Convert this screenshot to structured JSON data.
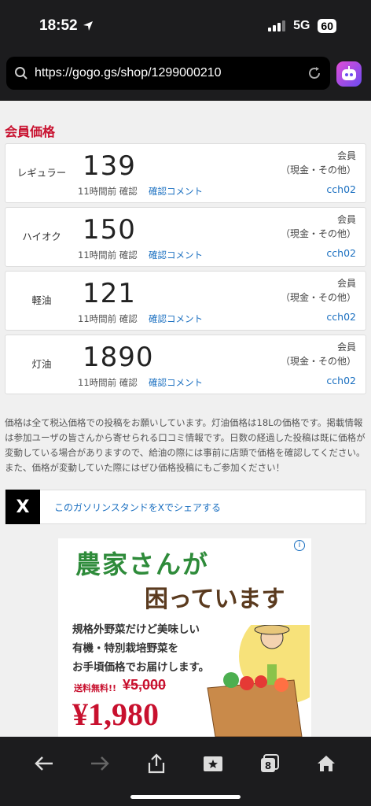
{
  "status": {
    "time": "18:52",
    "network": "5G",
    "battery": "60"
  },
  "browser": {
    "url": "https://gogo.gs/shop/1299000210"
  },
  "section_title": "会員価格",
  "prices": [
    {
      "label": "レギュラー",
      "price": "139",
      "time": "11時間前 確認",
      "comment": "確認コメント",
      "member": "会員",
      "pay": "（現金・その他）",
      "user": "cch02"
    },
    {
      "label": "ハイオク",
      "price": "150",
      "time": "11時間前 確認",
      "comment": "確認コメント",
      "member": "会員",
      "pay": "（現金・その他）",
      "user": "cch02"
    },
    {
      "label": "軽油",
      "price": "121",
      "time": "11時間前 確認",
      "comment": "確認コメント",
      "member": "会員",
      "pay": "（現金・その他）",
      "user": "cch02"
    },
    {
      "label": "灯油",
      "price": "1890",
      "time": "11時間前 確認",
      "comment": "確認コメント",
      "member": "会員",
      "pay": "（現金・その他）",
      "user": "cch02"
    }
  ],
  "notice": "価格は全て税込価格での投稿をお願いしています。灯油価格は18Lの価格です。掲載情報は参加ユーザの皆さんから寄せられる口コミ情報です。日数の経過した投稿は既に価格が変動している場合がありますので、給油の際には事前に店頭で価格を確認してください。 また、価格が変動していた際にはぜひ価格投稿にもご参加ください！",
  "share": {
    "logo": "X",
    "text": "このガソリンスタンドをXでシェアする"
  },
  "ad": {
    "headline1": "農家さんが",
    "headline2": "困っています",
    "line1": "規格外野菜だけど美味しい",
    "line2": "有機・特別栽培野菜を",
    "line3": "お手頃価格でお届けします。",
    "shipping": "送料無料!!",
    "old_price": "¥5,000",
    "price": "¥1,980",
    "info": "i"
  },
  "colors": {
    "accent_red": "#c8102e",
    "link_blue": "#1a6fc0",
    "dark_chrome": "#1c1c1e"
  }
}
